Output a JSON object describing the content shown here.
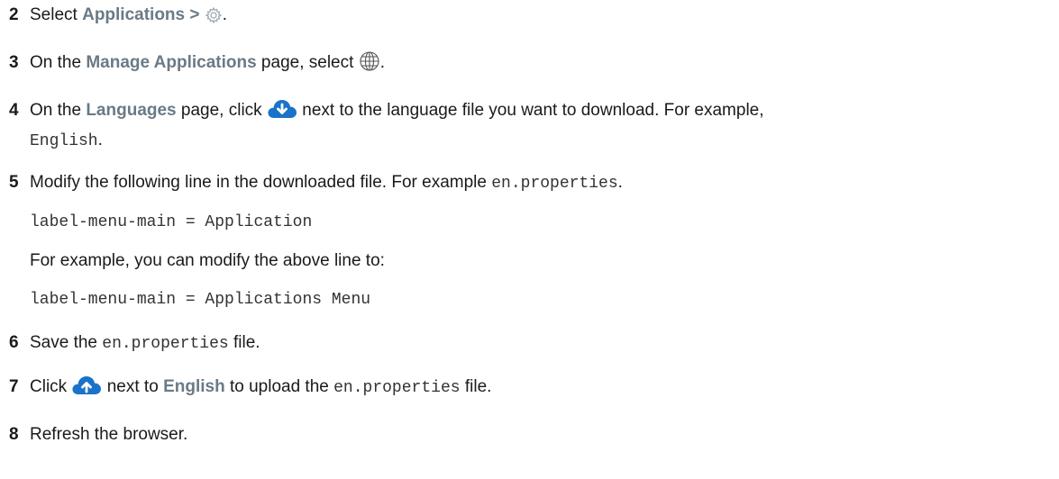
{
  "steps": [
    {
      "number": "2",
      "text_before": "Select ",
      "ui_label": "Applications >",
      "text_after": ".",
      "icon": "gear-icon"
    },
    {
      "number": "3",
      "text_before": "On the ",
      "ui_label": "Manage Applications",
      "text_middle": " page, select ",
      "text_after": ".",
      "icon": "globe-icon"
    },
    {
      "number": "4",
      "text_before": "On the ",
      "ui_label": "Languages",
      "text_middle": " page, click ",
      "text_after": " next to the language file you want to download. For example,",
      "line2_code": "English",
      "line2_after": ".",
      "icon": "cloud-download-icon"
    },
    {
      "number": "5",
      "text": "Modify the following line in the downloaded file. For example ",
      "code": "en.properties",
      "text_after": ".",
      "code_line_1": "label-menu-main = Application",
      "middle_text": "For example, you can modify the above line to:",
      "code_line_2": "label-menu-main = Applications Menu"
    },
    {
      "number": "6",
      "text_before": "Save the ",
      "code": "en.properties",
      "text_after": " file."
    },
    {
      "number": "7",
      "text_before": "Click ",
      "text_middle": " next to ",
      "ui_label": "English",
      "text_middle2": " to upload the ",
      "code": "en.properties",
      "text_after": " file.",
      "icon": "cloud-upload-icon"
    },
    {
      "number": "8",
      "text": "Refresh the browser."
    }
  ],
  "colors": {
    "ui_label": "#6a7a86",
    "cloud_icon": "#1a73c8"
  }
}
